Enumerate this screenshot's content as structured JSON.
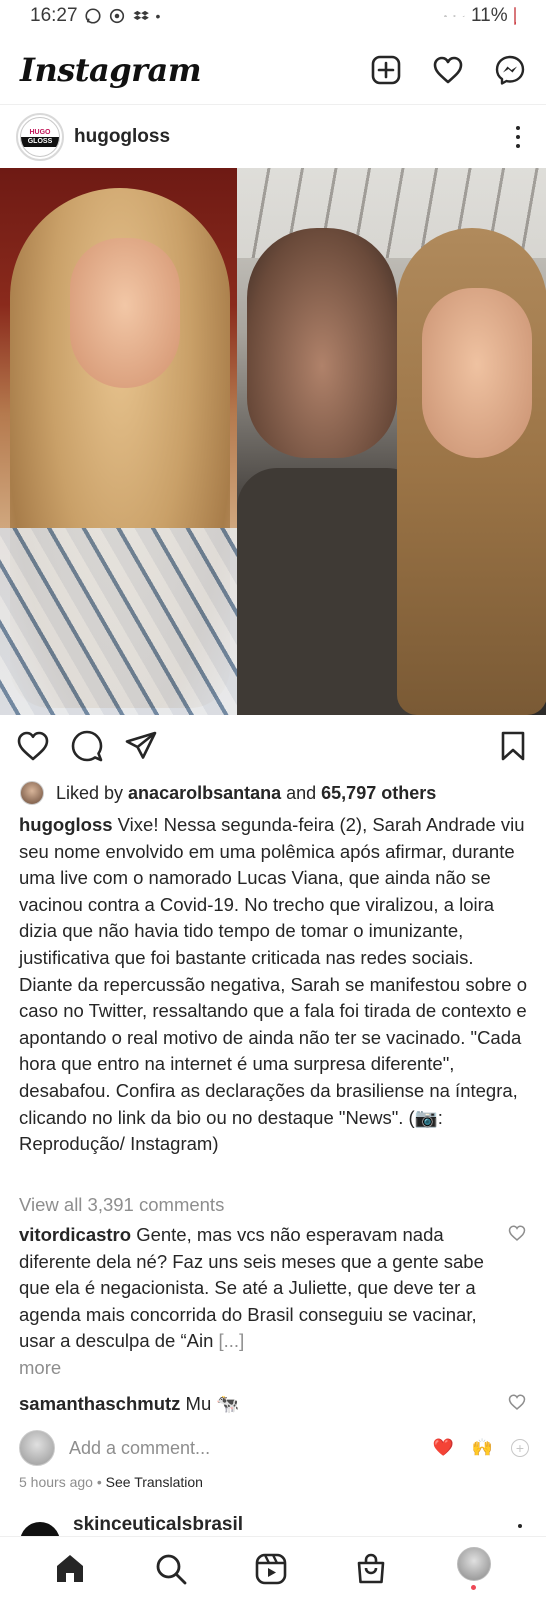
{
  "status_bar": {
    "time": "16:27",
    "battery": "11%"
  },
  "app": {
    "logo": "Instagram"
  },
  "post": {
    "username": "hugogloss",
    "avatar_text_top": "HUGO",
    "avatar_text_bottom": "GLOSS",
    "likes": {
      "prefix": "Liked by ",
      "user": "anacarolbsantana",
      "mid": " and ",
      "others": "65,797 others"
    },
    "caption": {
      "username": "hugogloss",
      "text": " Vixe! Nessa segunda-feira (2), Sarah Andrade viu seu nome envolvido em uma polêmica após afirmar, durante uma live com o namorado Lucas Viana, que ainda não se vacinou contra a Covid-19. No trecho que viralizou, a loira dizia que não havia tido tempo de tomar o imunizante, justificativa que foi bastante criticada nas redes sociais. Diante da repercussão negativa, Sarah se manifestou sobre o caso no Twitter, ressaltando que a fala foi tirada de contexto e apontando o real motivo de ainda não ter se vacinado. \"Cada hora que entro na internet é uma surpresa diferente\", desabafou. Confira as declarações da brasiliense na íntegra, clicando no link da bio ou no destaque \"News\". (📷: Reprodução/ Instagram)"
    },
    "view_all": "View all 3,391 comments",
    "comments": [
      {
        "username": "vitordicastro",
        "text": " Gente, mas vcs não esperavam nada diferente dela né? Faz uns seis meses que a gente sabe que ela é negacionista. Se até a Juliette, que deve ter a agenda mais concorrida do Brasil conseguiu se vacinar, usar a desculpa de “Ain ",
        "ellipsis": "[...]",
        "more": "more"
      },
      {
        "username": "samanthaschmutz",
        "text": " Mu 🐄"
      }
    ],
    "add_comment_placeholder": "Add a comment...",
    "quick_reactions": [
      "❤️",
      "🙌"
    ],
    "time_ago": "5 hours ago",
    "separator": " • ",
    "see_translation": "See Translation"
  },
  "next_post": {
    "username": "skinceuticalsbrasil"
  },
  "colors": {
    "like_red": "#ed4956",
    "muted": "#8e8e8e",
    "text": "#262626"
  }
}
